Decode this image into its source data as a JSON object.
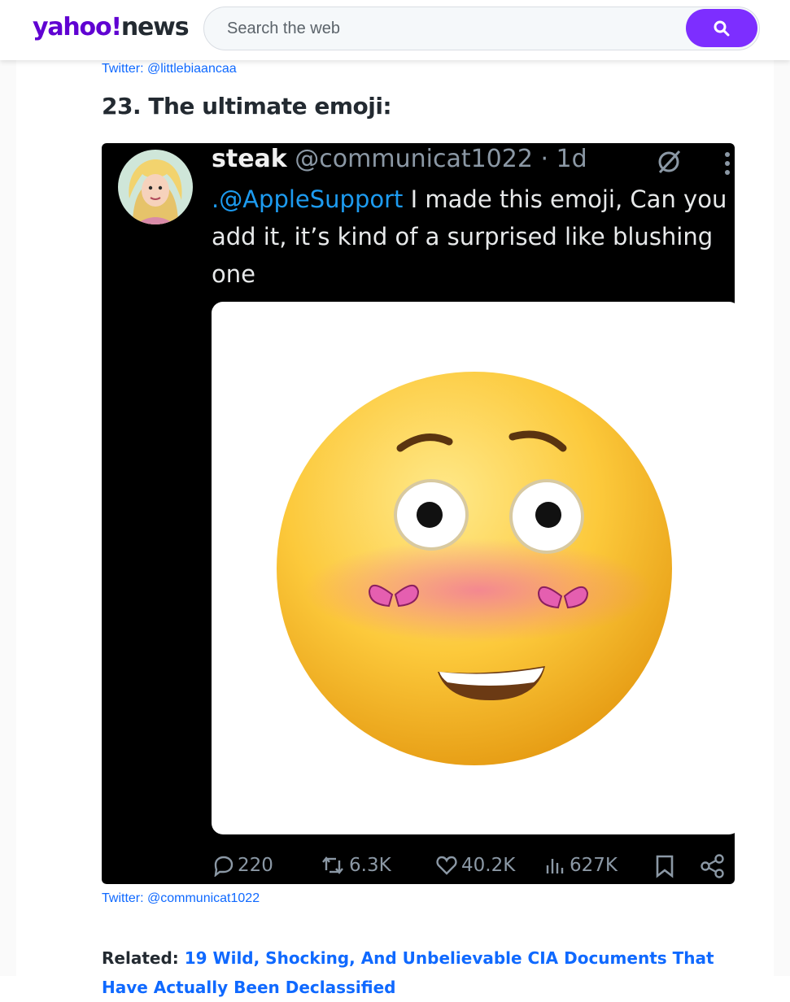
{
  "header": {
    "logo_brand": "yahoo!",
    "logo_section": "news",
    "search_placeholder": "Search the web",
    "search_icon": "search-icon"
  },
  "article": {
    "prev_credit": "Twitter: @littlebiaancaa",
    "item_heading": "23. The ultimate emoji:",
    "embed": {
      "name": "steak",
      "handle_time": "@communicat1022 · 1d",
      "mention": ".@AppleSupport",
      "text": " I made this emoji, Can you add it, it’s kind of a surprised like blushing one",
      "stats": {
        "replies": "220",
        "reposts": "6.3K",
        "likes": "40.2K",
        "views": "627K"
      }
    },
    "credit": "Twitter: @communicat1022",
    "related_label": "Related:",
    "related_link": "19 Wild, Shocking, And Unbelievable CIA Documents That Have Actually Been Declassified"
  },
  "colors": {
    "brand_purple": "#6001d2",
    "search_button": "#7d2eff",
    "link_blue": "#0f69ff",
    "mention_blue": "#1d9bf0"
  }
}
